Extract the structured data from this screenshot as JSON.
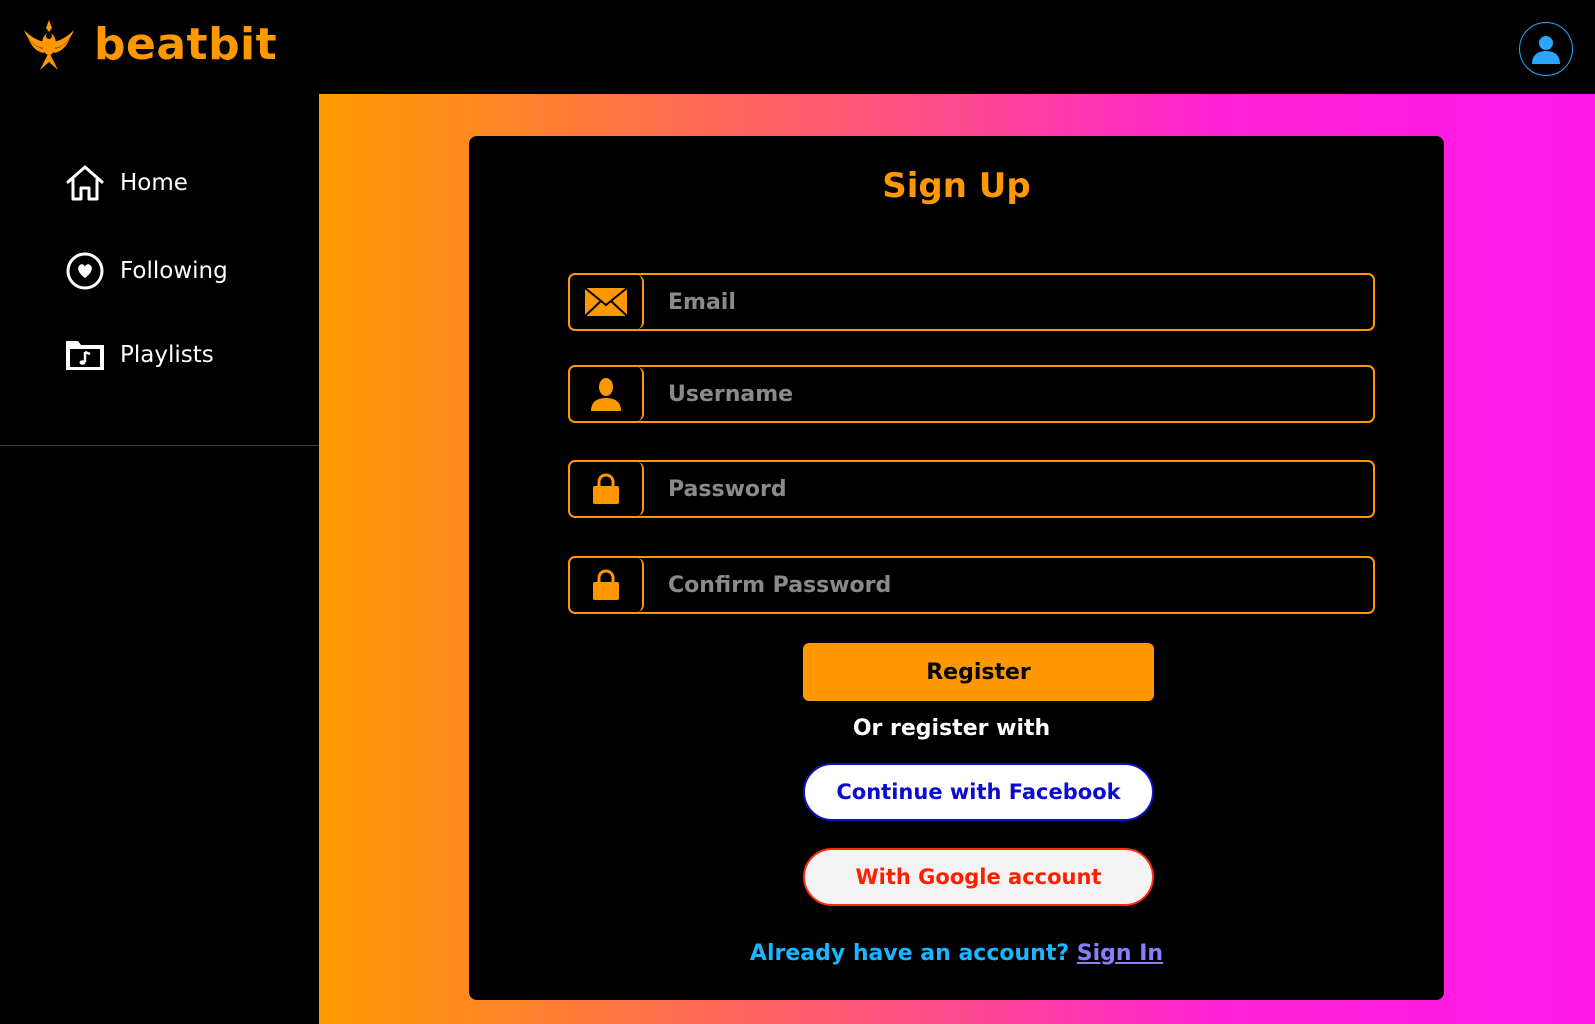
{
  "brand": {
    "name": "beatbit",
    "logo_icon": "phoenix-logo-icon",
    "color": "#ff9800"
  },
  "header": {
    "profile_icon": "user-avatar-icon"
  },
  "sidebar": {
    "items": [
      {
        "label": "Home",
        "icon": "home-icon"
      },
      {
        "label": "Following",
        "icon": "heart-circle-icon"
      },
      {
        "label": "Playlists",
        "icon": "music-folder-icon"
      }
    ]
  },
  "signup": {
    "title": "Sign Up",
    "fields": {
      "email": {
        "placeholder": "Email",
        "value": "",
        "icon": "envelope-icon"
      },
      "username": {
        "placeholder": "Username",
        "value": "",
        "icon": "user-icon"
      },
      "password": {
        "placeholder": "Password",
        "value": "",
        "icon": "lock-icon"
      },
      "confirm_password": {
        "placeholder": "Confirm Password",
        "value": "",
        "icon": "lock-icon"
      }
    },
    "register_label": "Register",
    "or_text": "Or register with",
    "facebook_label": "Continue with Facebook",
    "google_label": "With Google account",
    "signin_prompt": "Already have an account?",
    "signin_link": "Sign In"
  },
  "colors": {
    "accent": "#ff9800",
    "gradient_start": "#ff9a00",
    "gradient_end": "#ff1aec",
    "facebook": "#0a0ad0",
    "google": "#ff1e00",
    "signin_text": "#1ab6ff",
    "signin_link": "#8a7dff"
  }
}
